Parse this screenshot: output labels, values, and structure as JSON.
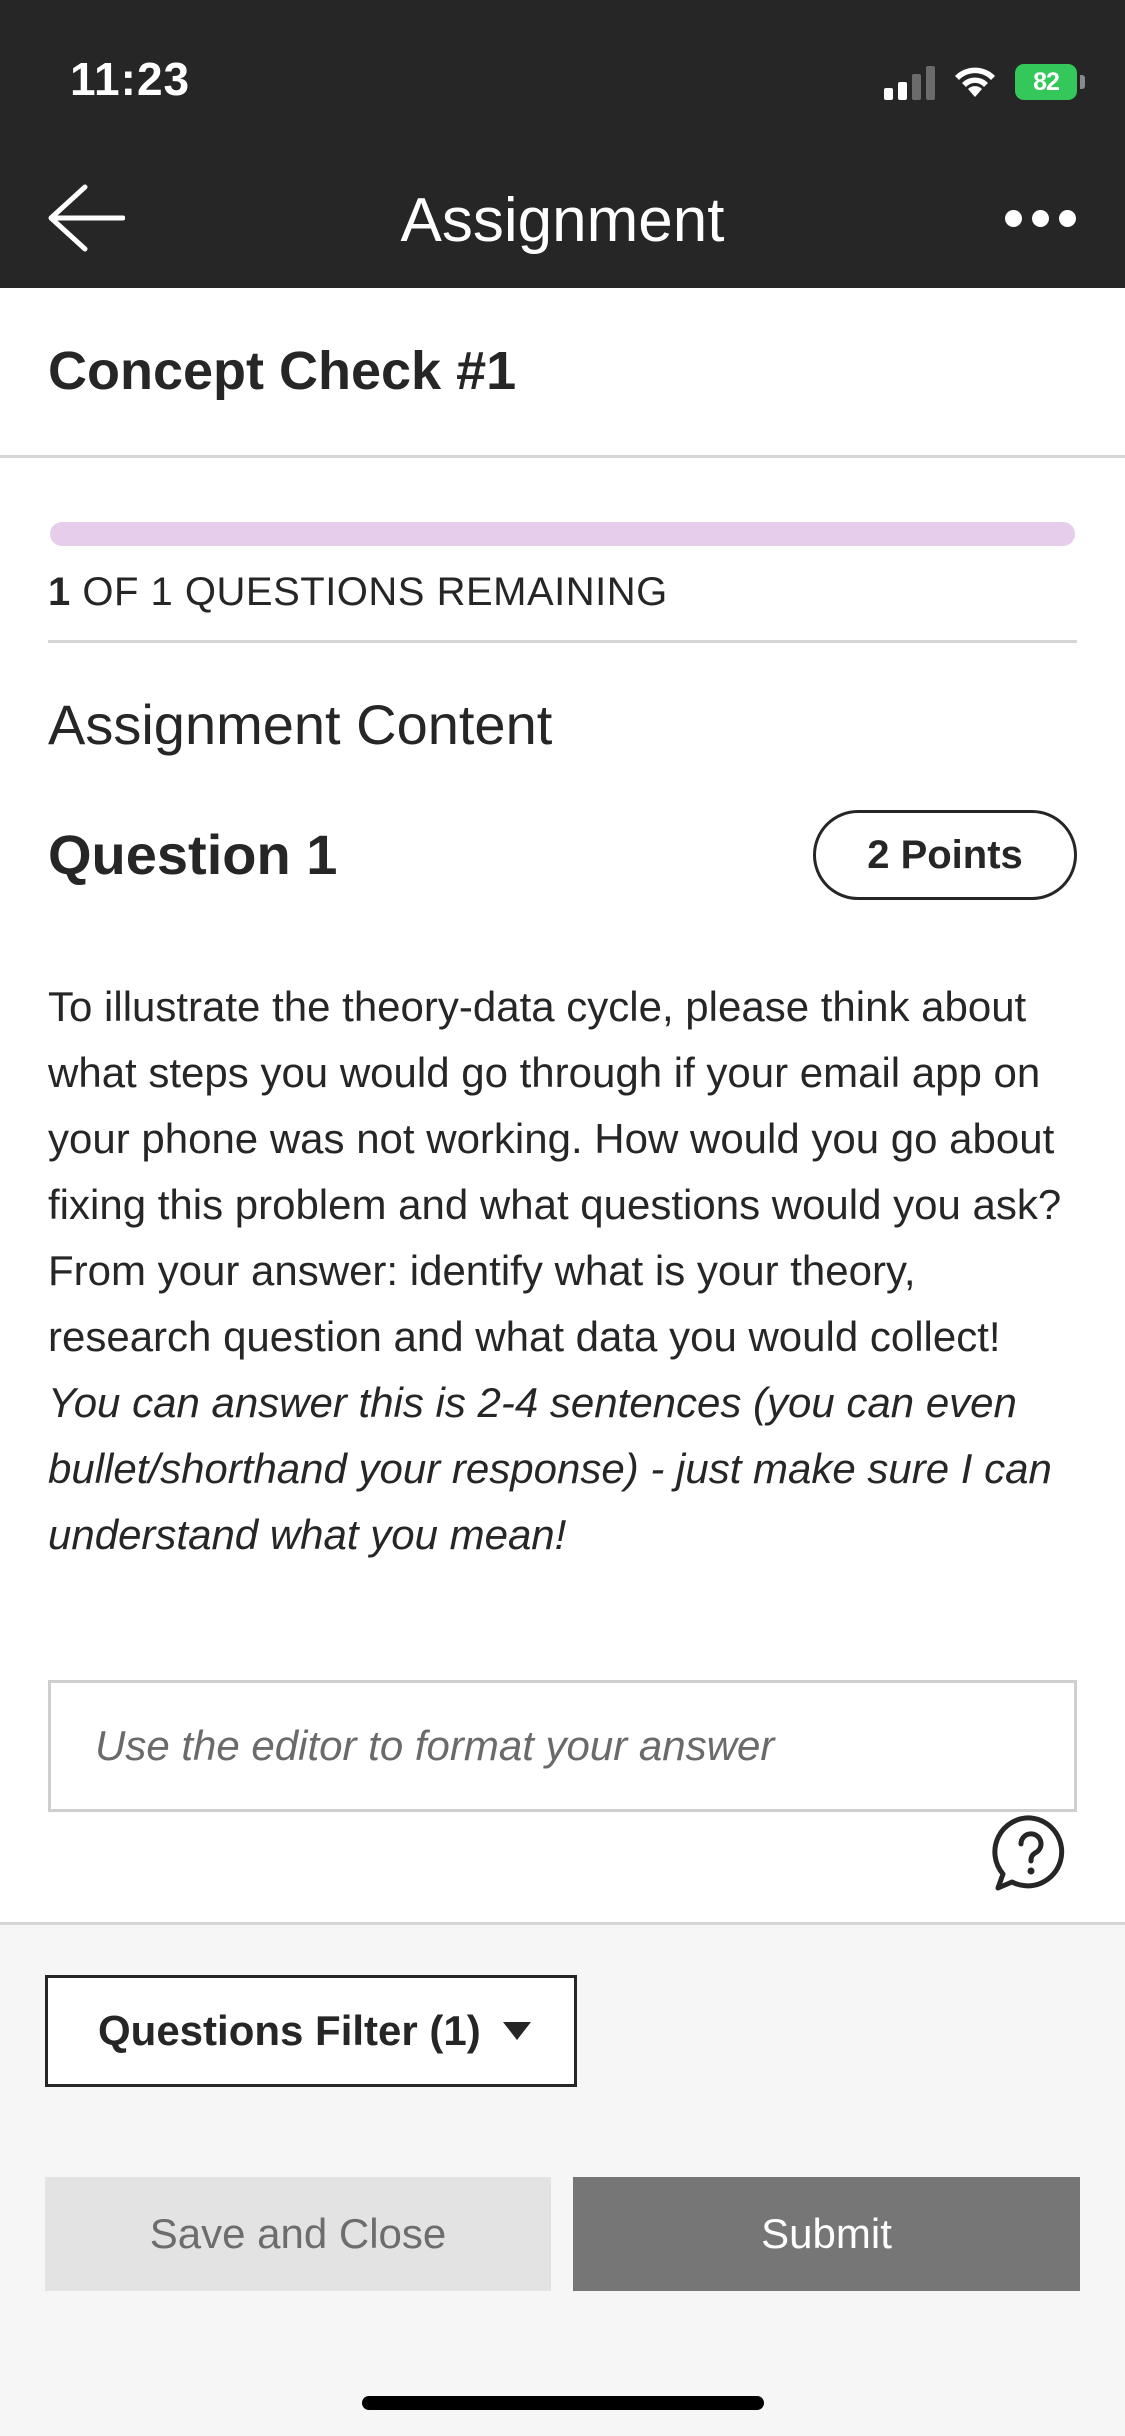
{
  "status_bar": {
    "time": "11:23",
    "battery_percent": "82"
  },
  "nav": {
    "title": "Assignment",
    "back_icon": "arrow-left-icon",
    "more_icon": "more-dots-icon"
  },
  "assignment": {
    "title": "Concept Check #1"
  },
  "progress": {
    "remaining_count": "1",
    "label_suffix": "OF 1 QUESTIONS REMAINING",
    "completed_fraction": 0,
    "track_color": "#e7cdec"
  },
  "content": {
    "section_heading": "Assignment Content",
    "question": {
      "heading": "Question 1",
      "points": "2 Points",
      "body": "To illustrate the theory-data cycle, please think about what steps you would go through if your email app on your phone was not working. How would you go about fixing this problem and what questions would you ask? From your answer: identify what is your theory, research question and what data you would collect!",
      "note": "You can answer this is 2-4 sentences (you can even bullet/shorthand your response) - just make sure I can understand what you mean!"
    },
    "answer_placeholder": "Use the editor to format your answer",
    "help_icon": "help-chat-icon"
  },
  "footer": {
    "filter_label": "Questions Filter (1)",
    "save_label": "Save and Close",
    "submit_label": "Submit"
  },
  "colors": {
    "header_bg": "#262626",
    "submit_bg": "#767676",
    "save_bg": "#e3e3e3",
    "battery": "#34c759"
  }
}
